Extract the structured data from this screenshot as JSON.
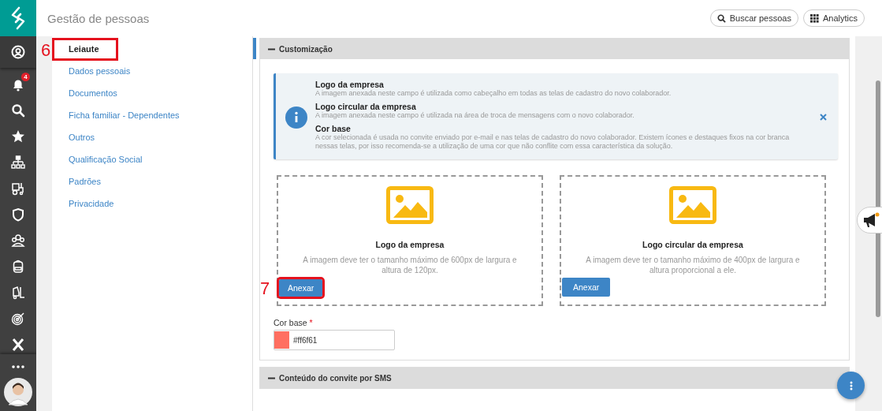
{
  "header": {
    "title": "Gestão de pessoas",
    "buttons": [
      {
        "kind": "search",
        "label": "Buscar pessoas"
      },
      {
        "kind": "grid",
        "label": "Analytics"
      }
    ]
  },
  "rail": {
    "notifications_badge": "4"
  },
  "nav": {
    "items": [
      {
        "label": "Leiaute",
        "selected": true,
        "annotation": "6"
      },
      {
        "label": "Dados pessoais",
        "selected": false
      },
      {
        "label": "Documentos",
        "selected": false
      },
      {
        "label": "Ficha familiar - Dependentes",
        "selected": false
      },
      {
        "label": "Outros",
        "selected": false
      },
      {
        "label": "Qualificação Social",
        "selected": false
      },
      {
        "label": "Padrões",
        "selected": false
      },
      {
        "label": "Privacidade",
        "selected": false
      }
    ]
  },
  "sections": [
    {
      "title": "Customização",
      "expanded": true
    },
    {
      "title": "Conteúdo do convite por SMS",
      "expanded": true
    }
  ],
  "info": {
    "items": [
      {
        "title": "Logo da empresa",
        "text": "A imagem anexada neste campo é utilizada como cabeçalho em todas as telas de cadastro do novo colaborador."
      },
      {
        "title": "Logo circular da empresa",
        "text": "A imagem anexada neste campo é utilizada na área de troca de mensagens com o novo colaborador."
      },
      {
        "title": "Cor base",
        "text": "A cor selecionada é usada no convite enviado por e-mail e nas telas de cadastro do novo colaborador. Existem ícones e destaques fixos na cor branca nessas telas, por isso recomenda-se a utilização de uma cor que não conflite com essa característica da solução."
      }
    ]
  },
  "uploads": [
    {
      "title": "Logo da empresa",
      "description": "A imagem deve ter o tamanho máximo de 600px de largura e altura de 120px.",
      "button": "Anexar",
      "annotation": "7"
    },
    {
      "title": "Logo circular da empresa",
      "description": "A imagem deve ter o tamanho máximo de 400px de largura e altura proporcional a ele.",
      "button": "Anexar"
    }
  ],
  "color_field": {
    "label": "Cor base",
    "required": true,
    "required_mark": "*",
    "value": "#ff6f61"
  }
}
